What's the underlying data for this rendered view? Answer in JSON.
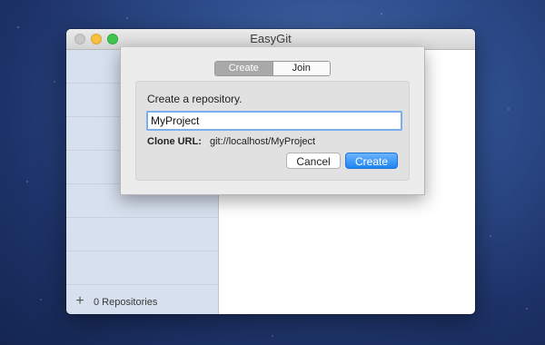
{
  "window": {
    "title": "EasyGit"
  },
  "sidebar": {
    "add_icon": "plus-icon",
    "add_glyph": "+",
    "repo_count": "0 Repositories"
  },
  "sheet": {
    "tabs": [
      {
        "label": "Create",
        "selected": true
      },
      {
        "label": "Join",
        "selected": false
      }
    ],
    "prompt": "Create a repository.",
    "name_input": {
      "value": "MyProject",
      "placeholder": ""
    },
    "clone_label": "Clone URL:",
    "clone_url": "git://localhost/MyProject",
    "cancel_label": "Cancel",
    "create_label": "Create"
  },
  "colors": {
    "accent": "#1f86f3",
    "focus_ring": "#7aaef0",
    "sidebar_bg": "#d7e0ee"
  }
}
